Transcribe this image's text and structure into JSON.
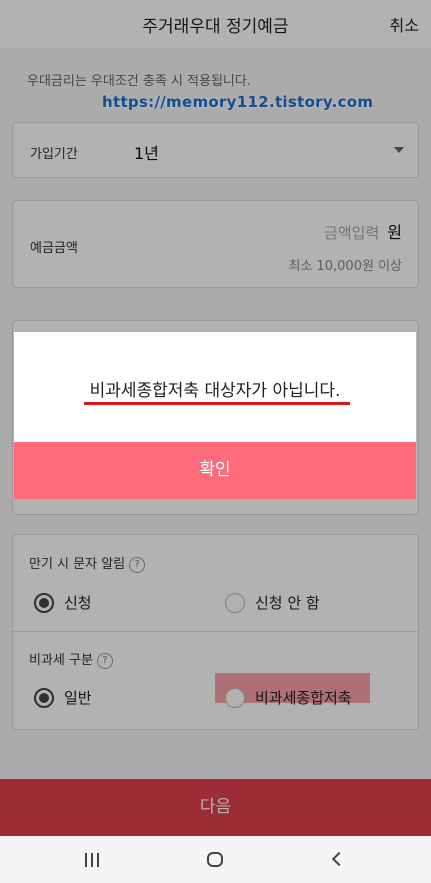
{
  "header": {
    "title": "주거래우대 정기예금",
    "cancel_label": "취소"
  },
  "notice": "우대금리는 우대조건 충족 시 적용됩니다.",
  "watermark": "https://memory112.tistory.com",
  "period": {
    "label": "가입기간",
    "value": "1년"
  },
  "amount": {
    "label": "예금금액",
    "placeholder": "금액입력",
    "unit": "원",
    "hint": "최소 10,000원 이상"
  },
  "sms_alert": {
    "label": "만기 시 문자 알림",
    "options": [
      {
        "label": "신청",
        "selected": true
      },
      {
        "label": "신청 안 함",
        "selected": false
      }
    ]
  },
  "tax": {
    "label": "비과세 구분",
    "options": [
      {
        "label": "일반",
        "selected": true
      },
      {
        "label": "비과세종합저축",
        "selected": false
      }
    ]
  },
  "help_icon_text": "?",
  "next_label": "다음",
  "dialog": {
    "message": "비과세종합저축 대상자가 아닙니다.",
    "confirm_label": "확인"
  },
  "icons": {
    "navbar": [
      "recent-apps-icon",
      "home-icon",
      "back-icon"
    ],
    "help": "help-icon",
    "dropdown": "caret-down-icon"
  },
  "colors": {
    "primary": "#e0404e",
    "confirm": "#ff6b7a",
    "underline": "#d41818",
    "watermark": "#1f6fd1"
  }
}
